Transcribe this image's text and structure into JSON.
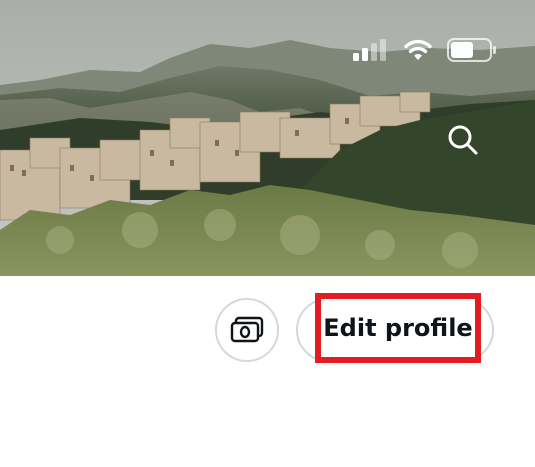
{
  "header": {
    "banner_image": "landscape-village-photo"
  },
  "status_bar": {
    "icons": [
      "cellular-signal-icon",
      "wifi-icon",
      "battery-icon"
    ]
  },
  "actions": {
    "search_icon": "search-icon",
    "tip_icon": "money-icon",
    "edit_profile_label": "Edit profile",
    "highlight_color": "#e41b23"
  }
}
